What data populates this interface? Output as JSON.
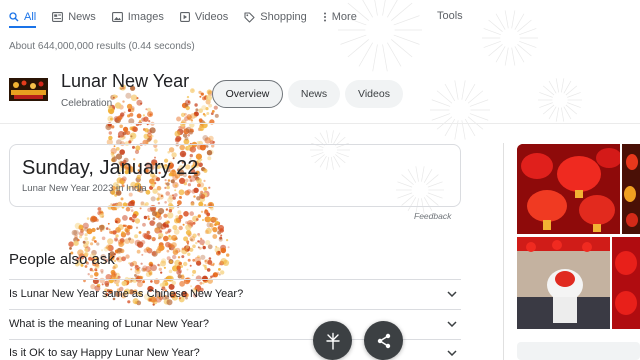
{
  "tabs": [
    {
      "label": "All",
      "icon": "search-icon"
    },
    {
      "label": "News",
      "icon": "news-icon"
    },
    {
      "label": "Images",
      "icon": "image-icon"
    },
    {
      "label": "Videos",
      "icon": "video-icon"
    },
    {
      "label": "Shopping",
      "icon": "tag-icon"
    },
    {
      "label": "More",
      "icon": "more-icon"
    }
  ],
  "tools_label": "Tools",
  "results_text": "About 644,000,000 results (0.44 seconds)",
  "knowledge_panel": {
    "title": "Lunar New Year",
    "subtitle": "Celebration",
    "chips": [
      "Overview",
      "News",
      "Videos"
    ]
  },
  "date_card": {
    "date": "Sunday, January 22",
    "caption": "Lunar New Year 2023 in India",
    "feedback": "Feedback"
  },
  "people_also_ask": {
    "title": "People also ask",
    "questions": [
      "Is Lunar New Year same as Chinese New Year?",
      "What is the meaning of Lunar New Year?",
      "Is it OK to say Happy Lunar New Year?"
    ]
  },
  "colors": {
    "accent": "#1a73e8",
    "fab": "#3c4043",
    "lantern_red": "#c8101a"
  }
}
